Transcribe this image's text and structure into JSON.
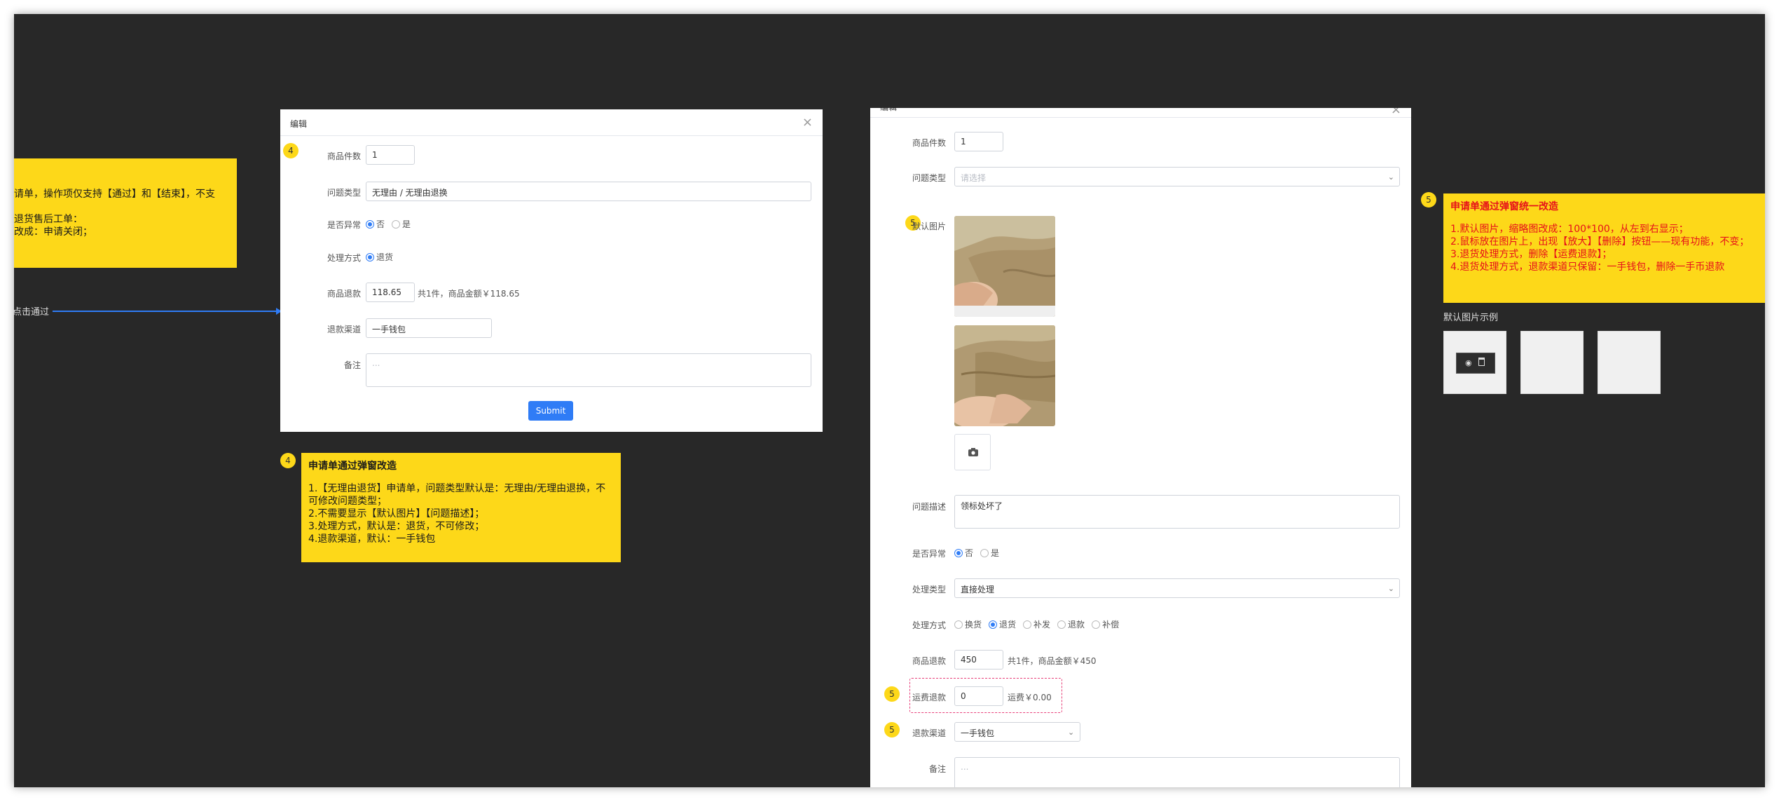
{
  "left_note": {
    "lines": [
      "请单，操作项仅支持【通过】和【结束】，不支",
      "",
      "退货售后工单：",
      "改成：申请关闭；"
    ]
  },
  "connector": {
    "label": "点击通过"
  },
  "dialog1": {
    "title": "编辑",
    "badge": "4",
    "fields": {
      "qty_label": "商品件数",
      "qty_value": "1",
      "type_label": "问题类型",
      "type_value": "无理由 / 无理由退换",
      "abnormal_label": "是否异常",
      "abnormal_no": "否",
      "abnormal_yes": "是",
      "method_label": "处理方式",
      "method_value": "退货",
      "refund_label": "商品退款",
      "refund_value": "118.65",
      "refund_suffix": "共1件，商品金额￥118.65",
      "channel_label": "退款渠道",
      "channel_value": "一手钱包",
      "remark_label": "备注",
      "remark_placeholder": "..."
    },
    "submit": "Submit"
  },
  "note4": {
    "badge": "4",
    "title": "申请单通过弹窗改造",
    "lines": [
      "1.【无理由退货】申请单，问题类型默认是：无理由/无理由退换，不可修改问题类型；",
      "2.不需要显示【默认图片】【问题描述】；",
      "3.处理方式，默认是：退货，不可修改；",
      "4.退款渠道，默认：一手钱包"
    ]
  },
  "dialog2": {
    "title": "编辑",
    "fields": {
      "qty_label": "商品件数",
      "qty_value": "1",
      "type_label": "问题类型",
      "type_placeholder": "请选择",
      "img_label": "默认图片",
      "desc_label": "问题描述",
      "desc_value": "领标处坏了",
      "abnormal_label": "是否异常",
      "abnormal_no": "否",
      "abnormal_yes": "是",
      "handle_type_label": "处理类型",
      "handle_type_value": "直接处理",
      "method_label": "处理方式",
      "methods": [
        "换货",
        "退货",
        "补发",
        "退款",
        "补偿"
      ],
      "refund_label": "商品退款",
      "refund_value": "450",
      "refund_suffix": "共1件，商品金额￥450",
      "freight_label": "运费退款",
      "freight_value": "0",
      "freight_suffix": "运费￥0.00",
      "channel_label": "退款渠道",
      "channel_value": "一手钱包",
      "remark_label": "备注",
      "remark_placeholder": "..."
    },
    "badges": {
      "img": "5",
      "freight": "5",
      "channel": "5"
    }
  },
  "note5": {
    "badge": "5",
    "title": "申请单通过弹窗统一改造",
    "lines": [
      "1.默认图片，缩略图改成：100*100，从左到右显示；",
      "2.鼠标放在图片上，出现【放大】【删除】按钮——现有功能，不变；",
      "3.退货处理方式，删除【运费退款】；",
      "4.退货处理方式，退款渠道只保留：一手钱包，删除一手币退款"
    ]
  },
  "example": {
    "label": "默认图片示例"
  },
  "colors": {
    "canvas": "#282828",
    "sticky": "#fdd819",
    "primary": "#2f7cf6",
    "note_red": "#e6101a"
  }
}
